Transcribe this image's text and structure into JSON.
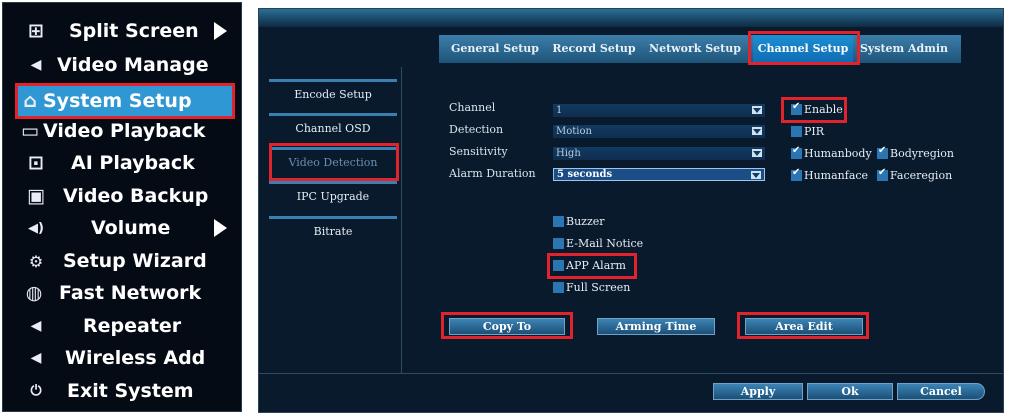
{
  "menu": {
    "items": [
      {
        "label": "Split Screen",
        "icon": "grid-icon",
        "glyph": "⊞",
        "has_submenu": true
      },
      {
        "label": "Video Manage",
        "icon": "camera-icon",
        "glyph": "◀",
        "has_submenu": false
      },
      {
        "label": "System Setup",
        "icon": "home-icon",
        "glyph": "⌂",
        "has_submenu": false,
        "active": true
      },
      {
        "label": "Video Playback",
        "icon": "video-icon",
        "glyph": "▭",
        "has_submenu": false
      },
      {
        "label": "AI Playback",
        "icon": "ai-playback-icon",
        "glyph": "⊡",
        "has_submenu": false
      },
      {
        "label": "Video Backup",
        "icon": "save-icon",
        "glyph": "▣",
        "has_submenu": false
      },
      {
        "label": "Volume",
        "icon": "volume-icon",
        "glyph": "◀)",
        "has_submenu": true
      },
      {
        "label": "Setup Wizard",
        "icon": "wizard-icon",
        "glyph": "⚙",
        "has_submenu": false
      },
      {
        "label": "Fast Network",
        "icon": "globe-icon",
        "glyph": "◍",
        "has_submenu": false
      },
      {
        "label": "Repeater",
        "icon": "camera-icon",
        "glyph": "◀",
        "has_submenu": false
      },
      {
        "label": "Wireless Add",
        "icon": "camera-icon",
        "glyph": "◀",
        "has_submenu": false
      },
      {
        "label": "Exit System",
        "icon": "power-icon",
        "glyph": "⏻",
        "has_submenu": false
      }
    ]
  },
  "tabs": [
    {
      "label": "General Setup"
    },
    {
      "label": "Record Setup"
    },
    {
      "label": "Network Setup"
    },
    {
      "label": "Channel Setup",
      "active": true
    },
    {
      "label": "System Admin"
    }
  ],
  "sidebar": [
    {
      "label": "Encode Setup"
    },
    {
      "label": "Channel OSD"
    },
    {
      "label": "Video Detection",
      "active": true
    },
    {
      "label": "IPC Upgrade"
    },
    {
      "label": "Bitrate"
    }
  ],
  "form": {
    "channel": {
      "label": "Channel",
      "value": "1"
    },
    "detection": {
      "label": "Detection",
      "value": "Motion"
    },
    "sensitivity": {
      "label": "Sensitivity",
      "value": "High"
    },
    "alarm_duration": {
      "label": "Alarm Duration",
      "value": "5 seconds"
    }
  },
  "checks": {
    "enable": {
      "label": "Enable",
      "checked": true
    },
    "pir": {
      "label": "PIR",
      "checked": false
    },
    "humanbody": {
      "label": "Humanbody",
      "checked": true
    },
    "bodyregion": {
      "label": "Bodyregion",
      "checked": true
    },
    "humanface": {
      "label": "Humanface",
      "checked": true
    },
    "faceregion": {
      "label": "Faceregion",
      "checked": true
    },
    "buzzer": {
      "label": "Buzzer",
      "checked": false
    },
    "email": {
      "label": "E-Mail Notice",
      "checked": false
    },
    "app_alarm": {
      "label": "APP Alarm",
      "checked": false
    },
    "full_screen": {
      "label": "Full Screen",
      "checked": false
    }
  },
  "buttons": {
    "copy_to": "Copy To",
    "arming_time": "Arming Time",
    "area_edit": "Area Edit",
    "apply": "Apply",
    "ok": "Ok",
    "cancel": "Cancel"
  },
  "colors": {
    "highlight": "#e0232d",
    "menu_active": "#2f97d3",
    "panel_bg": "#0a1a2d"
  }
}
